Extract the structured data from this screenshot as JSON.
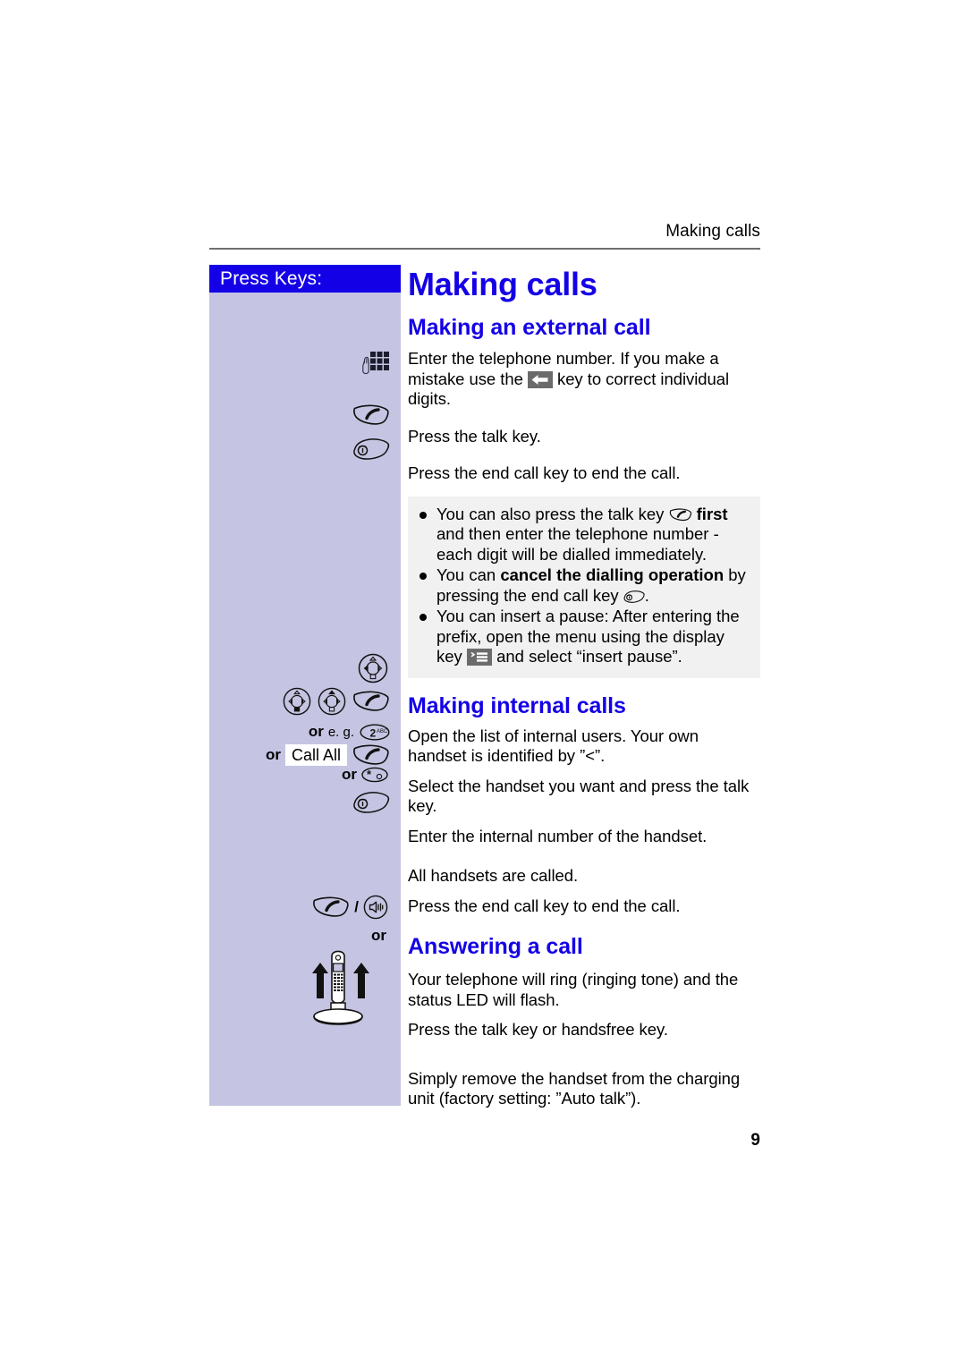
{
  "page": {
    "running_header": "Making calls",
    "page_number": "9",
    "accent_color": "#1400e6",
    "sidebar_color": "#c5c4e2",
    "note_box_color": "#f1f1f1"
  },
  "sidebar": {
    "title": "Press Keys:",
    "rows": [
      {
        "name": "keypad-row",
        "icon": "keypad-icon"
      },
      {
        "name": "talk-key-row",
        "icon": "talk-key-icon"
      },
      {
        "name": "end-call-key-row",
        "icon": "end-call-key-icon"
      },
      {
        "name": "nav-key-row",
        "icon": "navigation-key-icon"
      },
      {
        "name": "nav-select-talk-row",
        "icon": "navigation-key-icon"
      },
      {
        "name": "digit-key-row",
        "or_label": "or",
        "eg_label": "e. g.",
        "key_digit": "2",
        "key_letters": "ABC"
      },
      {
        "name": "call-all-row",
        "or_label": "or",
        "softkey_label": "Call All"
      },
      {
        "name": "star-key-row",
        "or_label": "or",
        "key_glyph": "star"
      },
      {
        "name": "end-call-key-row-2",
        "icon": "end-call-key-icon"
      },
      {
        "name": "talk-handsfree-row",
        "separator": "/"
      },
      {
        "name": "or-divider",
        "or_label": "or"
      },
      {
        "name": "handset-charger-row",
        "icon": "handset-on-charger-icon"
      }
    ]
  },
  "main": {
    "title": "Making calls",
    "sections": [
      {
        "heading": "Making an external call",
        "steps": [
          {
            "text_before": "Enter the telephone number. If you make a mistake use the ",
            "inline_icon": "backspace-key-icon",
            "text_after": " key to correct individual digits."
          },
          {
            "text": "Press the talk key."
          },
          {
            "text": "Press the end call key to end the call."
          }
        ],
        "notes": [
          {
            "part1": "You can also press the talk key ",
            "icon": "talk-key-icon",
            "bold1": "first",
            "part2": " and then enter the telephone number - each digit will be dialled immediately."
          },
          {
            "part1": "You can ",
            "bold1": "cancel the dialling operation",
            "part2": " by pressing the end call key ",
            "icon": "end-call-key-icon",
            "part3": "."
          },
          {
            "part1": "You can insert a pause: After entering the prefix, open the menu using the display key ",
            "icon": "display-key-icon",
            "part2": " and select “insert pause”."
          }
        ]
      },
      {
        "heading": "Making internal calls",
        "steps": [
          {
            "text": "Open the list of internal users. Your own handset is identified by ”<”."
          },
          {
            "text": "Select the handset you want and press the talk key."
          },
          {
            "text": "Enter the internal number of the handset."
          },
          {
            "text": "All handsets are called."
          },
          {
            "text": "Press the end call key to end the call."
          }
        ]
      },
      {
        "heading": "Answering a call",
        "steps": [
          {
            "text": "Your telephone will ring (ringing tone) and the status LED will flash."
          },
          {
            "text": "Press the talk key or handsfree key."
          },
          {
            "text": "Simply remove the handset from the charging unit (factory setting: ”Auto talk”)."
          }
        ]
      }
    ]
  }
}
